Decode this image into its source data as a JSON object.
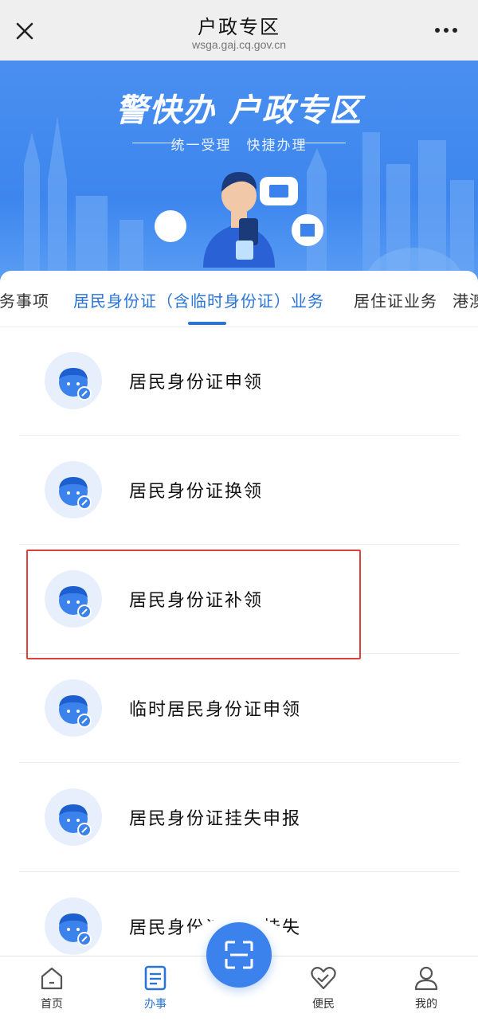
{
  "topbar": {
    "title": "户政专区",
    "url": "wsga.gaj.cq.gov.cn"
  },
  "banner": {
    "logo": "警快办 户政专区",
    "slogan": "统一受理　快捷办理"
  },
  "tabs": [
    {
      "label": "服务事项",
      "active": false
    },
    {
      "label": "居民身份证（含临时身份证）业务",
      "active": true
    },
    {
      "label": "居住证业务",
      "active": false
    },
    {
      "label": "港澳",
      "active": false
    }
  ],
  "items": [
    {
      "label": "居民身份证申领"
    },
    {
      "label": "居民身份证换领"
    },
    {
      "label": "居民身份证补领"
    },
    {
      "label": "临时居民身份证申领"
    },
    {
      "label": "居民身份证挂失申报"
    },
    {
      "label": "居民身份证解除挂失"
    }
  ],
  "nav": [
    {
      "label": "首页",
      "icon": "home-icon"
    },
    {
      "label": "办事",
      "icon": "document-icon"
    },
    {
      "label": "",
      "icon": "scan-icon"
    },
    {
      "label": "便民",
      "icon": "heart-icon"
    },
    {
      "label": "我的",
      "icon": "user-icon"
    }
  ],
  "colors": {
    "accent": "#2a74d4",
    "banner": "#3d86ee",
    "highlight": "#e0403a"
  }
}
